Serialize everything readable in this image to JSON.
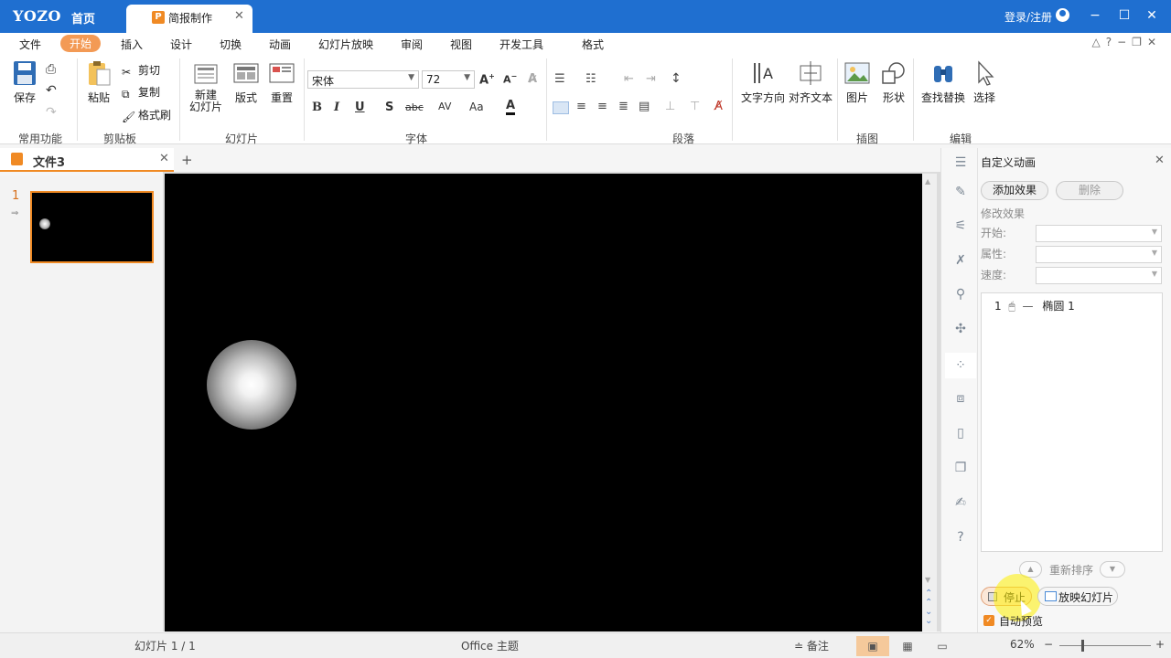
{
  "titlebar": {
    "brand": "YOZO",
    "home_tab": "首页",
    "doc_badge": "P",
    "doc_tab": "简报制作",
    "login": "登录/注册"
  },
  "menu": {
    "items": [
      "文件",
      "开始",
      "插入",
      "设计",
      "切换",
      "动画",
      "幻灯片放映",
      "审阅",
      "视图",
      "开发工具",
      "格式"
    ],
    "active": "开始"
  },
  "ribbon": {
    "common": {
      "save": "保存",
      "group": "常用功能"
    },
    "clipboard": {
      "paste": "粘贴",
      "cut": "剪切",
      "copy": "复制",
      "format_painter": "格式刷",
      "group": "剪贴板"
    },
    "slides": {
      "new_slide_line1": "新建",
      "new_slide_line2": "幻灯片",
      "layout": "版式",
      "reset": "重置",
      "group": "幻灯片"
    },
    "font": {
      "name": "宋体",
      "size": "72",
      "group": "字体"
    },
    "paragraph": {
      "text_direction": "文字方向",
      "align_text": "对齐文本",
      "group": "段落"
    },
    "illustrations": {
      "picture": "图片",
      "shape": "形状",
      "group": "插图"
    },
    "editing": {
      "find_replace": "查找替换",
      "select": "选择",
      "group": "编辑"
    }
  },
  "document": {
    "name": "文件3",
    "slide_number": "1"
  },
  "panel": {
    "title": "自定义动画",
    "add_effect": "添加效果",
    "delete": "删除",
    "modify_label": "修改效果",
    "start_label": "开始:",
    "property_label": "属性:",
    "speed_label": "速度:",
    "animation_items": [
      {
        "index": "1",
        "name": "椭圆 1"
      }
    ],
    "reorder": "重新排序",
    "stop": "停止",
    "play": "放映幻灯片",
    "auto_preview": "自动预览"
  },
  "status": {
    "slide_info": "幻灯片 1 / 1",
    "theme": "Office 主题",
    "notes": "备注",
    "zoom": "62%"
  },
  "colors": {
    "title_bar": "#1f6fd0",
    "accent": "#f08a24",
    "slide_background": "#000000"
  }
}
